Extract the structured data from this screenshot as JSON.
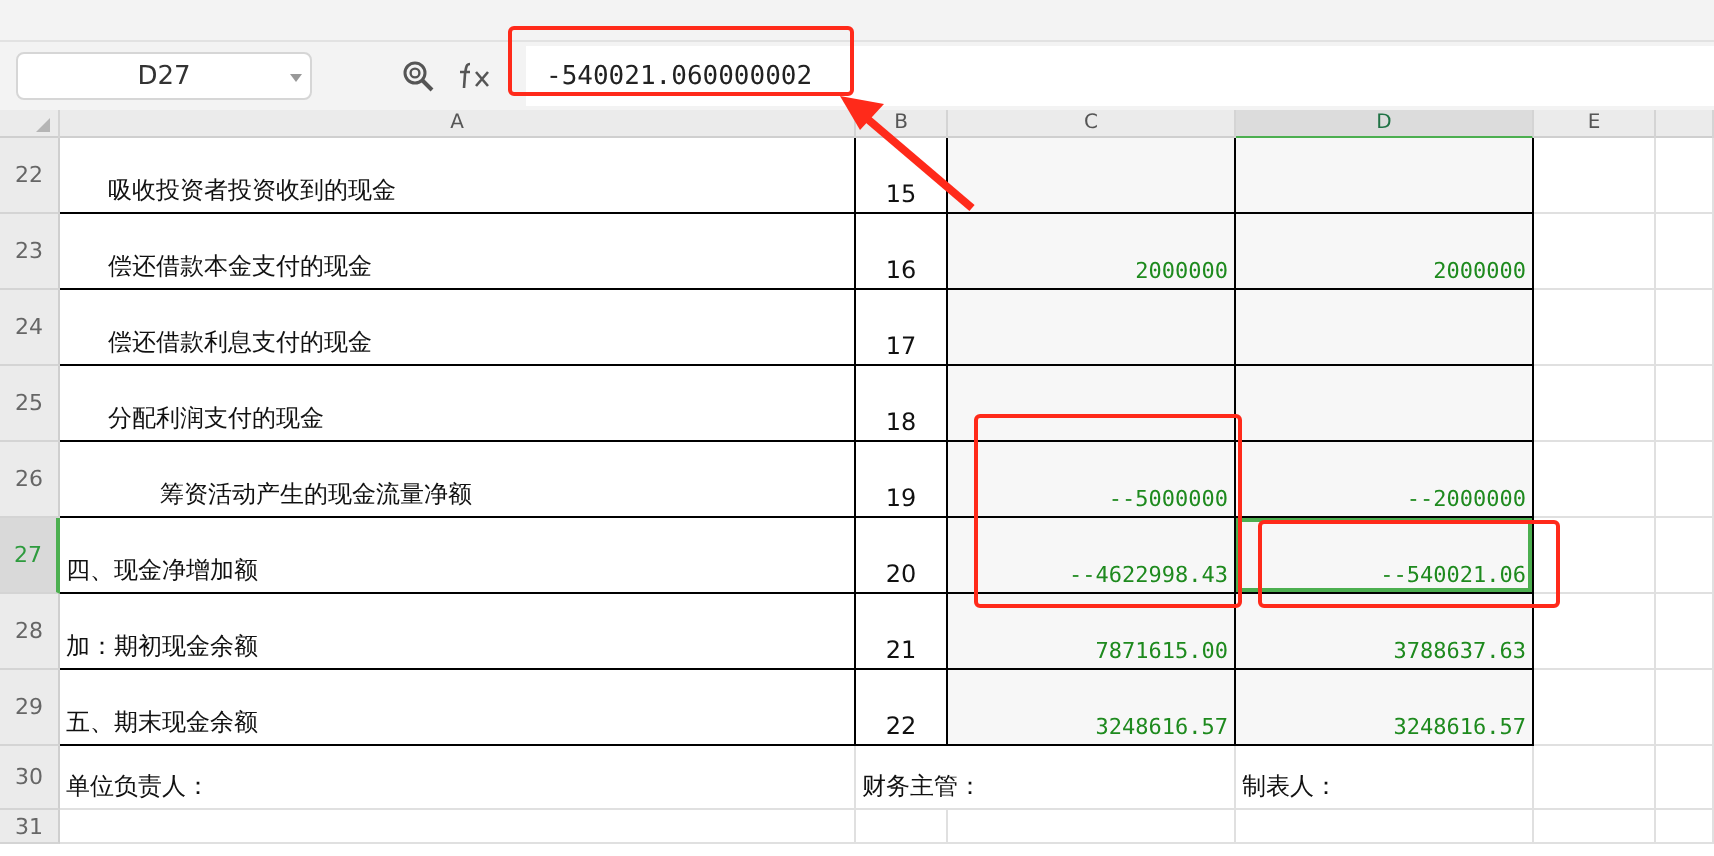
{
  "name_box": {
    "value": "D27"
  },
  "formula_bar": {
    "value": "-540021.060000002"
  },
  "columns": [
    {
      "label": "A",
      "selected": false
    },
    {
      "label": "B",
      "selected": false
    },
    {
      "label": "C",
      "selected": false
    },
    {
      "label": "D",
      "selected": true
    },
    {
      "label": "E",
      "selected": false
    }
  ],
  "rows": [
    {
      "number": "22",
      "selected": false,
      "kind": "item",
      "a": "吸收投资者投资收到的现金",
      "b": "15"
    },
    {
      "number": "23",
      "selected": false,
      "kind": "item",
      "a": "偿还借款本金支付的现金",
      "b": "16",
      "c": "2000000",
      "d": "2000000"
    },
    {
      "number": "24",
      "selected": false,
      "kind": "item",
      "a": "偿还借款利息支付的现金",
      "b": "17"
    },
    {
      "number": "25",
      "selected": false,
      "kind": "item",
      "a": "分配利润支付的现金",
      "b": "18"
    },
    {
      "number": "26",
      "selected": false,
      "kind": "subtotal",
      "a": "筹资活动产生的现金流量净额",
      "b": "19",
      "c": "--5000000",
      "d": "--2000000"
    },
    {
      "number": "27",
      "selected": true,
      "kind": "heading",
      "a": "四、现金净增加额",
      "b": "20",
      "c": "--4622998.43",
      "d": "--540021.06"
    },
    {
      "number": "28",
      "selected": false,
      "kind": "heading",
      "a": "加：期初现金余额",
      "b": "21",
      "c": "7871615.00",
      "d": "3788637.63"
    },
    {
      "number": "29",
      "selected": false,
      "kind": "heading",
      "a": "五、期末现金余额",
      "b": "22",
      "c": "3248616.57",
      "d": "3248616.57"
    },
    {
      "number": "30",
      "selected": false,
      "kind": "signature",
      "a": "单位负责人：",
      "b": "财务主管：",
      "d": "制表人："
    },
    {
      "number": "31",
      "selected": false,
      "kind": "blank"
    }
  ]
}
